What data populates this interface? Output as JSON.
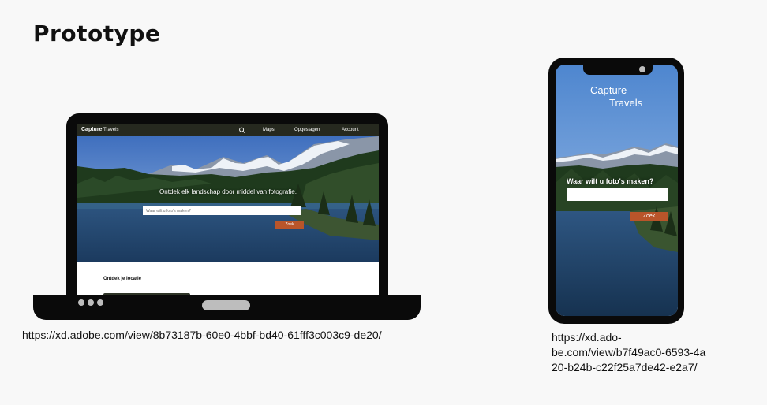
{
  "page": {
    "title": "Prototype"
  },
  "desktop": {
    "logo_main": "Capture",
    "logo_sub": "Travels",
    "nav": [
      "Maps",
      "Opgeslagen",
      "Account"
    ],
    "headline": "Ontdek elk landschap door middel van fotografie.",
    "search_placeholder": "Waar wilt u foto's maken?",
    "search_button": "Zoek",
    "section_title": "Ontdek je locatie",
    "url": "https://xd.adobe.com/view/8b73187b-60e0-4bbf-bd40-61fff3c003c9-de20/"
  },
  "mobile": {
    "logo_line1": "Capture",
    "logo_line2": "Travels",
    "question": "Waar wilt u foto's maken?",
    "search_placeholder": "",
    "search_button": "Zoek",
    "url_lines": [
      "https://xd.ado-",
      "be.com/view/b7f49ac0-6593-4a",
      "20-b24b-c22f25a7de42-e2a7/"
    ]
  },
  "colors": {
    "nav_bg": "#26291f",
    "accent_button": "#b9552a",
    "device_frame": "#0a0a0a",
    "page_bg": "#f8f8f8"
  }
}
